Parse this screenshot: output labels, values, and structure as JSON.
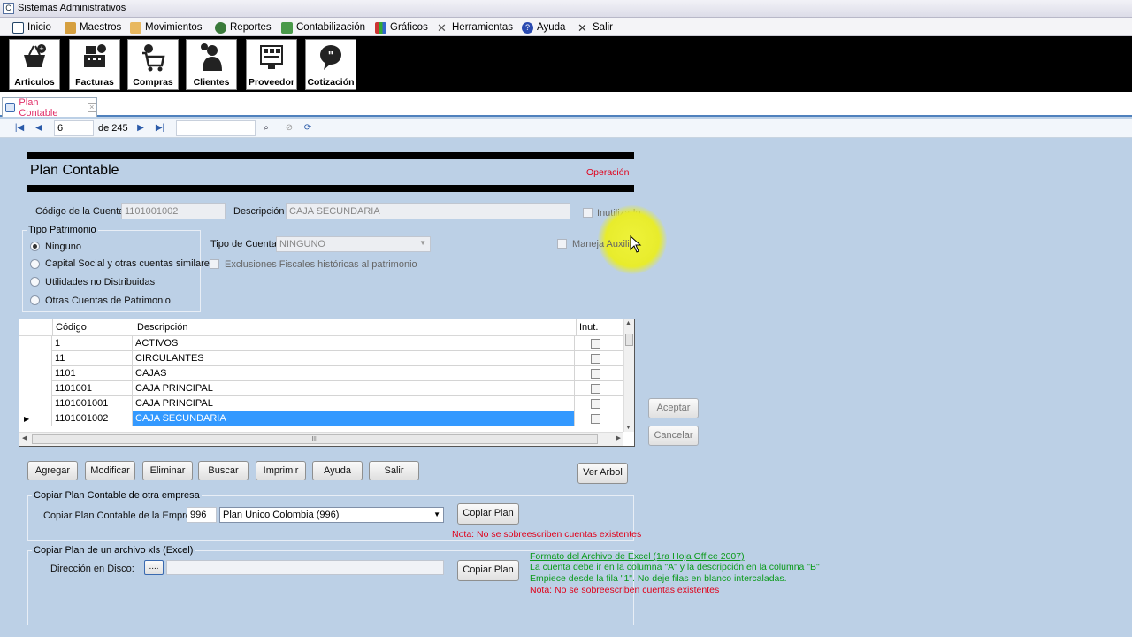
{
  "window": {
    "title": "Sistemas Administrativos"
  },
  "menu": [
    "Inicio",
    "Maestros",
    "Movimientos",
    "Reportes",
    "Contabilización",
    "Gráficos",
    "Herramientas",
    "Ayuda",
    "Salir"
  ],
  "toolbar": [
    "Articulos",
    "Facturas",
    "Compras",
    "Clientes",
    "Proveedor",
    "Cotización"
  ],
  "tab": {
    "label": "Plan Contable"
  },
  "navigator": {
    "position": "6",
    "of_total": "de 245",
    "search_value": ""
  },
  "form": {
    "title": "Plan Contable",
    "mode": "Operación",
    "codigo_label": "Código de la Cuenta",
    "codigo_value": "1101001002",
    "descripcion_label": "Descripción",
    "descripcion_value": "CAJA SECUNDARIA",
    "inutilizado_label": "Inutilizado",
    "tipo_patrimonio": {
      "title": "Tipo Patrimonio",
      "options": [
        "Ninguno",
        "Capital Social y otras cuentas similares",
        "Utilidades no Distribuidas",
        "Otras Cuentas de Patrimonio"
      ],
      "selected": "Ninguno"
    },
    "tipo_cuenta_label": "Tipo de Cuenta",
    "tipo_cuenta_value": "NINGUNO",
    "maneja_auxiliar_label": "Maneja Auxiliar",
    "exclusiones_label": "Exclusiones Fiscales históricas al patrimonio"
  },
  "grid": {
    "columns": [
      "Código",
      "Descripción",
      "Inut."
    ],
    "rows": [
      {
        "codigo": "1",
        "descripcion": "ACTIVOS"
      },
      {
        "codigo": "11",
        "descripcion": "CIRCULANTES"
      },
      {
        "codigo": "1101",
        "descripcion": "CAJAS"
      },
      {
        "codigo": "1101001",
        "descripcion": "CAJA PRINCIPAL"
      },
      {
        "codigo": "1101001001",
        "descripcion": "CAJA PRINCIPAL"
      },
      {
        "codigo": "1101001002",
        "descripcion": "CAJA SECUNDARIA"
      }
    ],
    "selected_row": 5,
    "hscroll_glyph": "III"
  },
  "side_buttons": {
    "aceptar": "Aceptar",
    "cancelar": "Cancelar"
  },
  "actions": [
    "Agregar",
    "Modificar",
    "Eliminar",
    "Buscar",
    "Imprimir",
    "Ayuda",
    "Salir"
  ],
  "ver_arbol": "Ver Arbol",
  "copy_company": {
    "title": "Copiar Plan Contable de otra empresa",
    "label": "Copiar Plan Contable de la Empresa",
    "code": "996",
    "selected": "Plan Unico Colombia (996)",
    "button": "Copiar Plan",
    "note": "Nota: No se sobreescriben cuentas existentes"
  },
  "copy_excel": {
    "title": "Copiar Plan de un archivo xls (Excel)",
    "label": "Dirección en Disco:",
    "browse": "....",
    "path": "",
    "button": "Copiar Plan",
    "format_title": "Formato del Archivo de Excel (1ra Hoja Office 2007)",
    "line1": "La cuenta debe ir en la columna \"A\" y la descripción en la columna \"B\"",
    "line2": "Empiece  desde la fila \"1\". No deje filas en blanco intercaladas.",
    "note": "Nota: No se sobreescriben cuentas existentes"
  },
  "colors": {
    "accent": "#4f81bd",
    "selection": "#3399ff",
    "note": "#e0001a",
    "hint": "#0a9a1a",
    "background": "#bcd0e6"
  }
}
